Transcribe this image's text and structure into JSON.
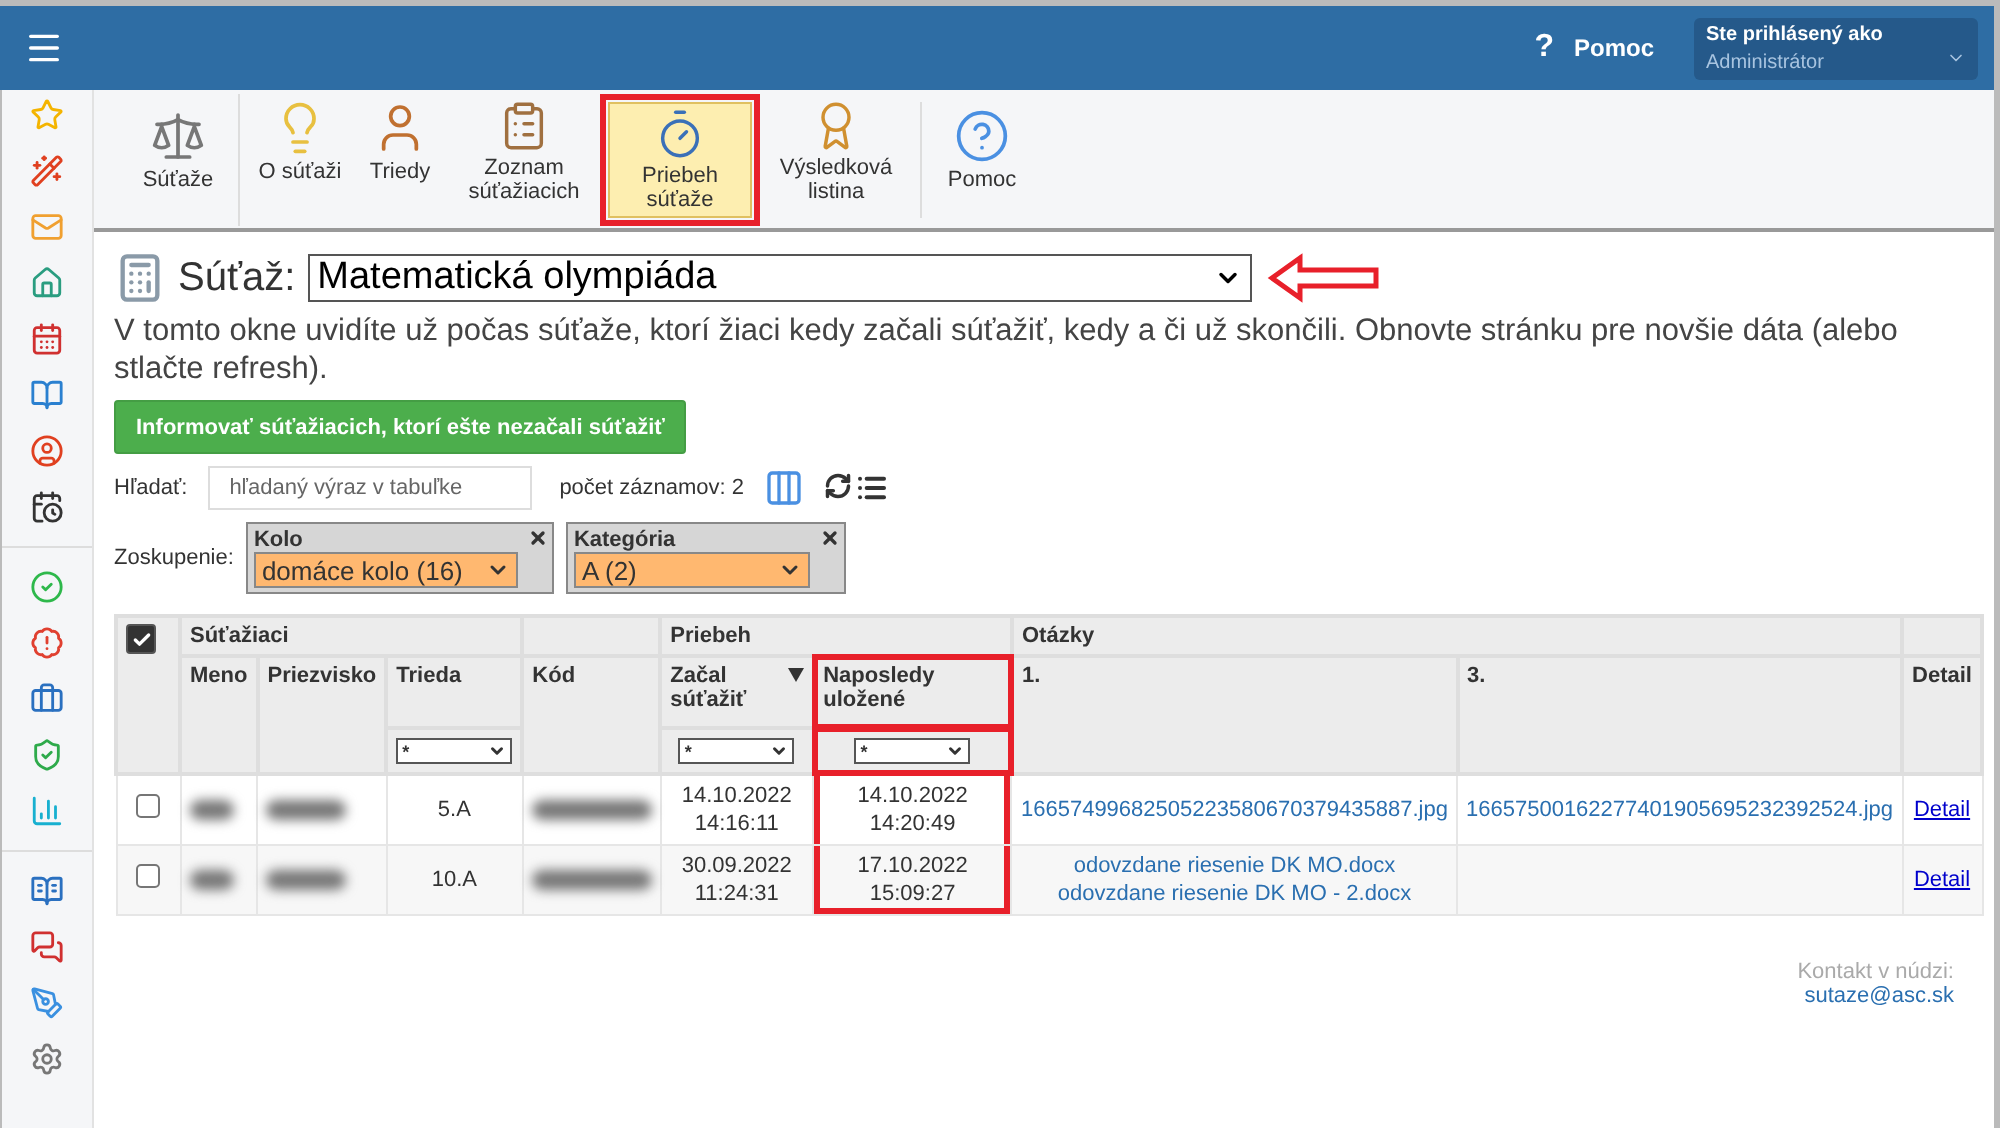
{
  "topbar": {
    "help_icon": "?",
    "help": "Pomoc",
    "user_label": "Ste prihlásený ako",
    "user_value": "Administrátor"
  },
  "toolbar": {
    "groups": [
      [
        {
          "kind": "scales",
          "label": "Súťaže",
          "selected": false
        }
      ],
      [
        {
          "kind": "bulb",
          "label": "O súťaži",
          "selected": false
        },
        {
          "kind": "person",
          "label": "Triedy",
          "selected": false
        },
        {
          "kind": "clipboard",
          "label": "Zoznam súťažiacich",
          "selected": false
        },
        {
          "kind": "stopwatch",
          "label": "Priebeh súťaže",
          "selected": true,
          "highlighted": true
        },
        {
          "kind": "certificate",
          "label": "Výsledková listina",
          "selected": false
        }
      ],
      [
        {
          "kind": "help",
          "label": "Pomoc",
          "selected": false
        }
      ]
    ]
  },
  "contest": {
    "label": "Súťaž:",
    "value": "Matematická olympiáda",
    "pointed": true
  },
  "description": "V tomto okne uvidíte už počas súťaže, ktorí žiaci kedy začali súťažiť, kedy a či už skončili. Obnovte stránku pre novšie dáta (alebo stlačte refresh).",
  "notify_button": "Informovať súťažiacich, ktorí ešte nezačali súťažiť",
  "search": {
    "label": "Hľadať:",
    "placeholder": "hľadaný výraz v tabuľke",
    "count": "počet záznamov: 2"
  },
  "grouping": {
    "label": "Zoskupenie:",
    "filters": [
      {
        "title": "Kolo",
        "value": "domáce kolo (16)"
      },
      {
        "title": "Kategória",
        "value": "A (2)"
      }
    ]
  },
  "table": {
    "select_all_checked": true,
    "groups": [
      "Súťažiaci",
      "Priebeh",
      "Otázky"
    ],
    "columns": [
      {
        "label": "Meno"
      },
      {
        "label": "Priezvisko"
      },
      {
        "label": "Trieda",
        "filter": "*"
      },
      {
        "label": "Kód"
      },
      {
        "label": "Začal súťažiť",
        "filter": "*",
        "sorted": true
      },
      {
        "label": "Naposledy uložené",
        "filter": "*",
        "highlighted": true
      },
      {
        "label": "1."
      },
      {
        "label": "3."
      },
      {
        "label": "Detail"
      }
    ],
    "rows": [
      {
        "checked": false,
        "class": "5.A",
        "started": [
          "14.10.2022",
          "14:16:11"
        ],
        "saved": [
          "14.10.2022",
          "14:20:49"
        ],
        "q1": [
          "16657499682505223580670379435887.jpg"
        ],
        "q3": [
          "16657500162277401905695232392524.jpg"
        ],
        "detail": "Detail"
      },
      {
        "checked": false,
        "class": "10.A",
        "started": [
          "30.09.2022",
          "11:24:31"
        ],
        "saved": [
          "17.10.2022",
          "15:09:27"
        ],
        "q1": [
          "odovzdane riesenie DK MO.docx",
          "odovzdane riesenie DK MO - 2.docx"
        ],
        "detail": "Detail"
      }
    ]
  },
  "footer": {
    "contact": "Kontakt v núdzi:",
    "email": "sutaze@asc.sk"
  }
}
